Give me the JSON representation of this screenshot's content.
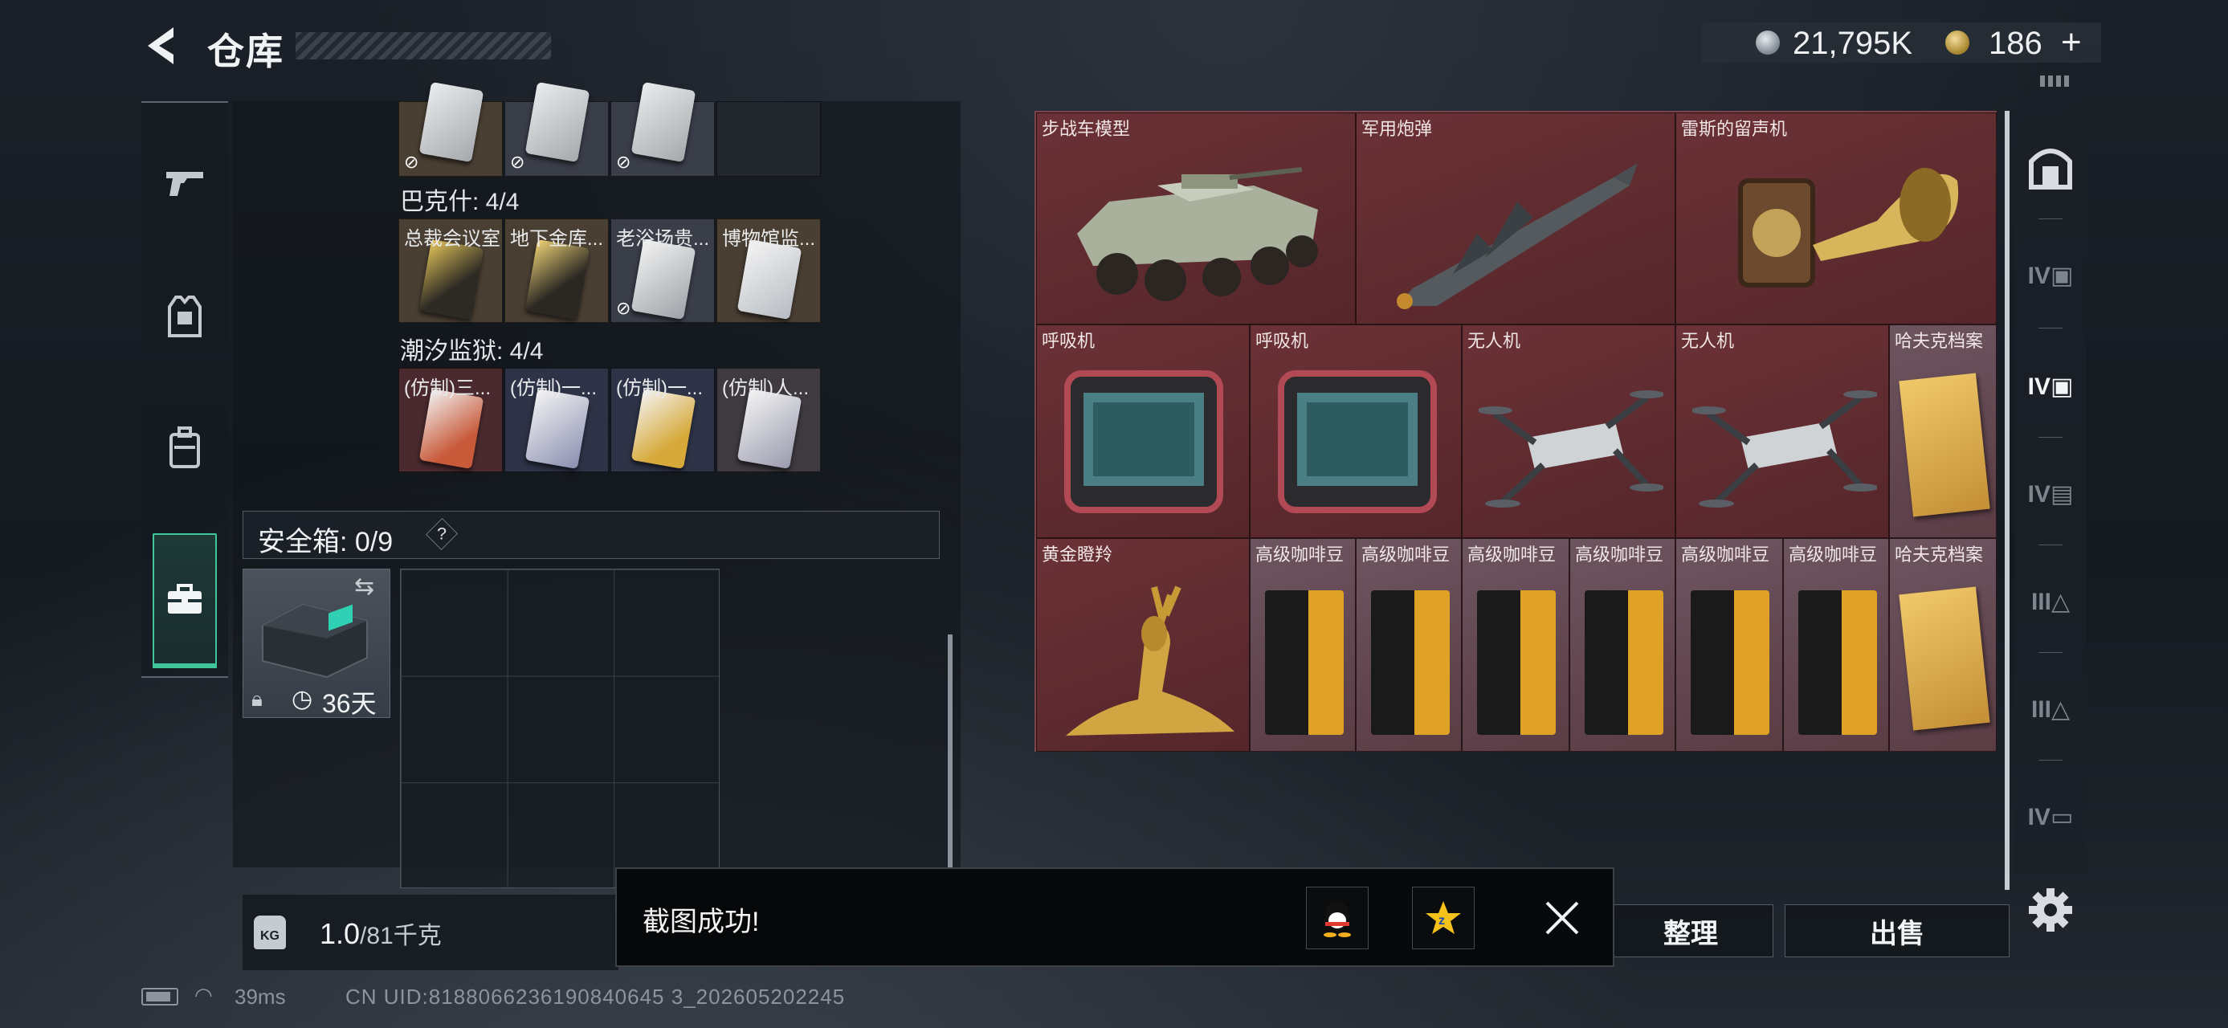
{
  "header": {
    "title": "仓库",
    "back_icon": "back-arrow-icon"
  },
  "currency": {
    "silver": "21,795K",
    "gold": "186",
    "plus": "+"
  },
  "left_rail": {
    "items": [
      "pistol-icon",
      "armor-vest-icon",
      "backpack-icon",
      "toolbox-icon"
    ],
    "selected": "toolbox-icon"
  },
  "inventory": {
    "groups": [
      {
        "title": "巴克什: 4/4",
        "cards": [
          "总裁会议室",
          "地下金库...",
          "老浴场贵...",
          "博物馆监..."
        ]
      },
      {
        "title": "潮汐监狱: 4/4",
        "cards": [
          "(仿制)三...",
          "(仿制)一...",
          "(仿制)一...",
          "(仿制)人..."
        ]
      }
    ],
    "safe": {
      "label": "安全箱: 0/9",
      "help": "?",
      "timer": "36天"
    },
    "weight": {
      "current": "1.0",
      "max": "/81千克",
      "icon_text": "KG"
    }
  },
  "stash": {
    "items": [
      {
        "label": "步战车模型"
      },
      {
        "label": "军用炮弹"
      },
      {
        "label": "雷斯的留声机"
      },
      {
        "label": "呼吸机"
      },
      {
        "label": "呼吸机"
      },
      {
        "label": "无人机"
      },
      {
        "label": "无人机"
      },
      {
        "label": "哈夫克档案"
      },
      {
        "label": "黄金瞪羚"
      },
      {
        "label": "高级咖啡豆"
      },
      {
        "label": "高级咖啡豆"
      },
      {
        "label": "高级咖啡豆"
      },
      {
        "label": "高级咖啡豆"
      },
      {
        "label": "高级咖啡豆"
      },
      {
        "label": "高级咖啡豆"
      },
      {
        "label": "哈夫克档案"
      }
    ]
  },
  "right_tabs": [
    "vault-icon",
    "IV-stash-icon",
    "IV-stash-selected-icon",
    "IV-stash-icon",
    "III-stash-icon",
    "III-stash-icon",
    "IV-stash-icon"
  ],
  "buttons": {
    "tidy": "整理",
    "sell": "出售"
  },
  "toast": {
    "text": "截图成功!"
  },
  "status": {
    "ping": "39ms",
    "uid": "CN UID:8188066236190840645 3_202605202245"
  },
  "colors": {
    "stash_bg": "#5a2a2e",
    "accent_green": "#3fc79a",
    "gold": "#d4a93c"
  }
}
